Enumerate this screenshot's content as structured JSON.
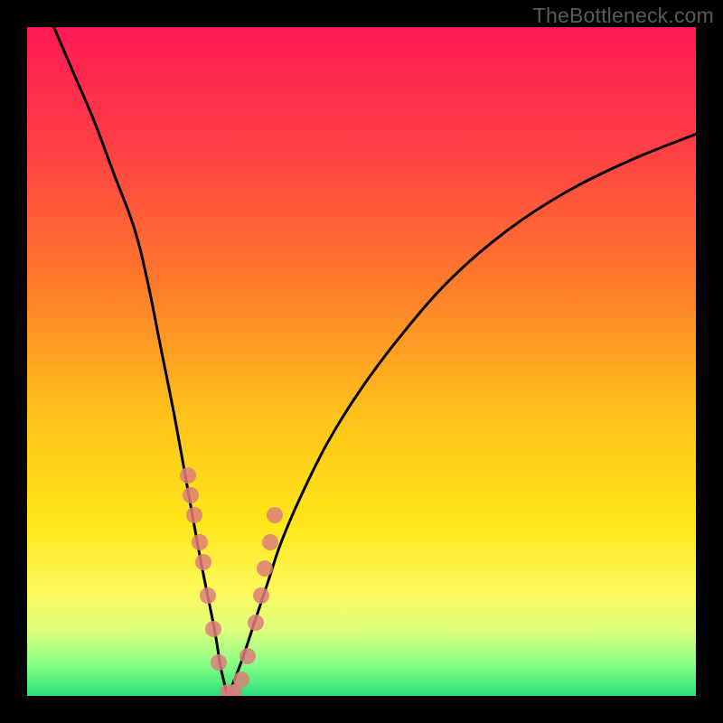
{
  "watermark": "TheBottleneck.com",
  "colors": {
    "frame": "#000000",
    "curve": "#000000",
    "dot": "#dd7e7b",
    "gradient_stops": [
      {
        "offset": 0.0,
        "color": "#ff1a54"
      },
      {
        "offset": 0.18,
        "color": "#ff3f46"
      },
      {
        "offset": 0.38,
        "color": "#ff7a2c"
      },
      {
        "offset": 0.58,
        "color": "#ffc21a"
      },
      {
        "offset": 0.74,
        "color": "#ffe619"
      },
      {
        "offset": 0.84,
        "color": "#fff85a"
      },
      {
        "offset": 0.9,
        "color": "#dfff7a"
      },
      {
        "offset": 0.95,
        "color": "#8dff86"
      },
      {
        "offset": 1.0,
        "color": "#29e07a"
      }
    ]
  },
  "chart_data": {
    "type": "line",
    "title": "",
    "xlabel": "",
    "ylabel": "",
    "xlim": [
      0,
      100
    ],
    "ylim": [
      0,
      100
    ],
    "notes": "Bottleneck-style V curve. Left branch descends steeply from top-left; right branch rises with decreasing slope toward upper right. Minimum (value 0) occurs around x≈28–32. Pink dots cluster along both branches in the lower ~35% of the chart height.",
    "series": [
      {
        "name": "left-branch",
        "x": [
          4,
          7,
          10,
          13,
          16,
          18,
          20,
          22,
          24,
          26,
          28,
          29,
          30
        ],
        "values": [
          100,
          93,
          86,
          78,
          70,
          62,
          52,
          42,
          31,
          20,
          10,
          4,
          0
        ]
      },
      {
        "name": "right-branch",
        "x": [
          30,
          32,
          34,
          36,
          38,
          41,
          45,
          50,
          56,
          63,
          71,
          80,
          90,
          100
        ],
        "values": [
          0,
          5,
          11,
          17,
          23,
          30,
          38,
          46,
          54,
          62,
          69,
          75,
          80,
          84
        ]
      }
    ],
    "scatter": {
      "name": "dots",
      "x": [
        24.0,
        24.5,
        25.0,
        25.8,
        26.3,
        27.0,
        27.8,
        28.6,
        30.0,
        31.0,
        32.0,
        33.0,
        34.2,
        35.0,
        35.6,
        36.3,
        37.0
      ],
      "values": [
        33.0,
        30.0,
        27.0,
        23.0,
        20.0,
        15.0,
        10.0,
        5.0,
        0.5,
        0.5,
        2.5,
        6.0,
        11.0,
        15.0,
        19.0,
        23.0,
        27.0
      ]
    }
  }
}
